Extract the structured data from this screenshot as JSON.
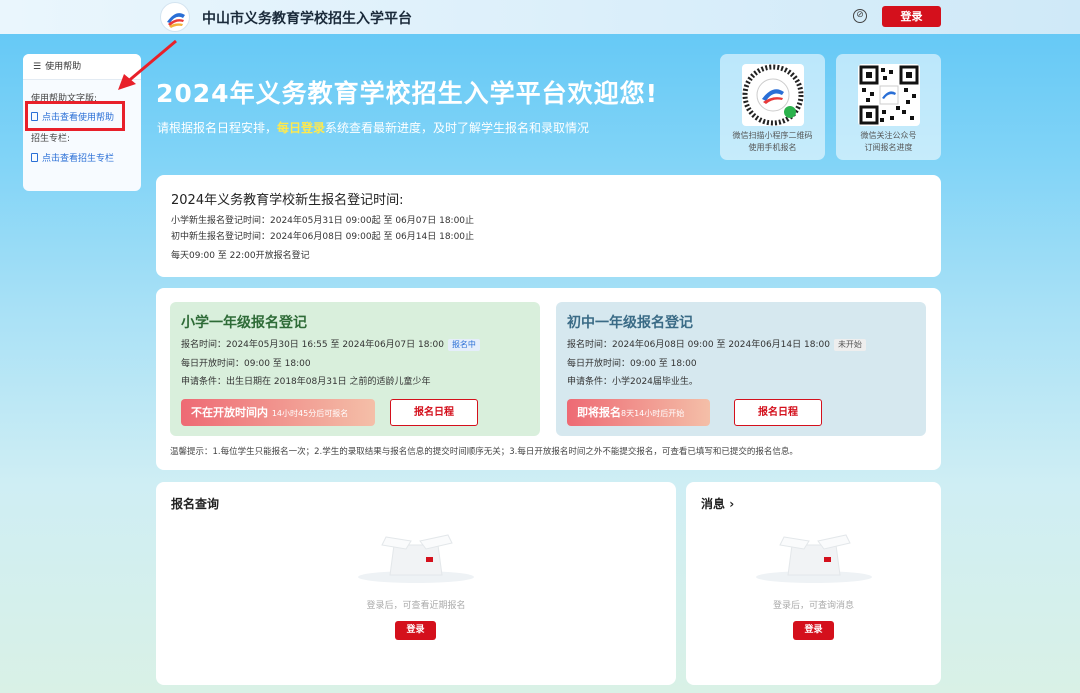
{
  "header": {
    "title": "中山市义务教育学校招生入学平台",
    "login_label": "登录",
    "help_glyph": "⊘"
  },
  "sidebar": {
    "heading": "使用帮助",
    "text_version_label": "使用帮助文字版:",
    "help_link": "点击查看使用帮助",
    "column_label": "招生专栏:",
    "column_link": "点击查看招生专栏"
  },
  "hero": {
    "title": "2024年义务教育学校招生入学平台欢迎您!",
    "sub_before": "请根据报名日程安排，",
    "sub_highlight": "每日登录",
    "sub_after": "系统查看最新进度，及时了解学生报名和录取情况",
    "qr_miniprogram": {
      "line1": "微信扫描小程序二维码",
      "line2": "使用手机报名"
    },
    "qr_official": {
      "line1": "微信关注公众号",
      "line2": "订阅报名进度"
    }
  },
  "registration_time": {
    "title": "2024年义务教育学校新生报名登记时间:",
    "primary": "小学新生报名登记时间：2024年05月31日 09:00起 至 06月07日 18:00止",
    "junior": "初中新生报名登记时间：2024年06月08日 09:00起 至 06月14日 18:00止",
    "daily": "每天09:00 至 22:00开放报名登记"
  },
  "primary_panel": {
    "title": "小学一年级报名登记",
    "time": "报名时间：2024年05月30日 16:55 至 2024年06月07日 18:00",
    "status": "报名中",
    "daily": "每日开放时间：09:00 至 18:00",
    "condition": "申请条件：出生日期在 2018年08月31日 之前的适龄儿童少年",
    "action_main": "不在开放时间内",
    "action_sub": "14小时45分后可报名",
    "schedule_label": "报名日程"
  },
  "junior_panel": {
    "title": "初中一年级报名登记",
    "time": "报名时间：2024年06月08日 09:00 至 2024年06月14日 18:00",
    "status": "未开始",
    "daily": "每日开放时间：09:00 至 18:00",
    "condition": "申请条件：小学2024届毕业生。",
    "action_main": "即将报名",
    "action_sub": "8天14小时后开始",
    "schedule_label": "报名日程"
  },
  "tip": "温馨提示：1.每位学生只能报名一次；2.学生的录取结果与报名信息的提交时间顺序无关；3.每日开放报名时间之外不能提交报名，可查看已填写和已提交的报名信息。",
  "query": {
    "title": "报名查询",
    "empty_text": "登录后，可查看近期报名",
    "login_label": "登录"
  },
  "messages": {
    "title": "消息",
    "chevron": "›",
    "empty_text": "登录后，可查询消息",
    "login_label": "登录"
  },
  "colors": {
    "brand_red": "#d4101c",
    "highlight_yellow": "#ffe94d",
    "annotation_red": "#e8202a"
  }
}
